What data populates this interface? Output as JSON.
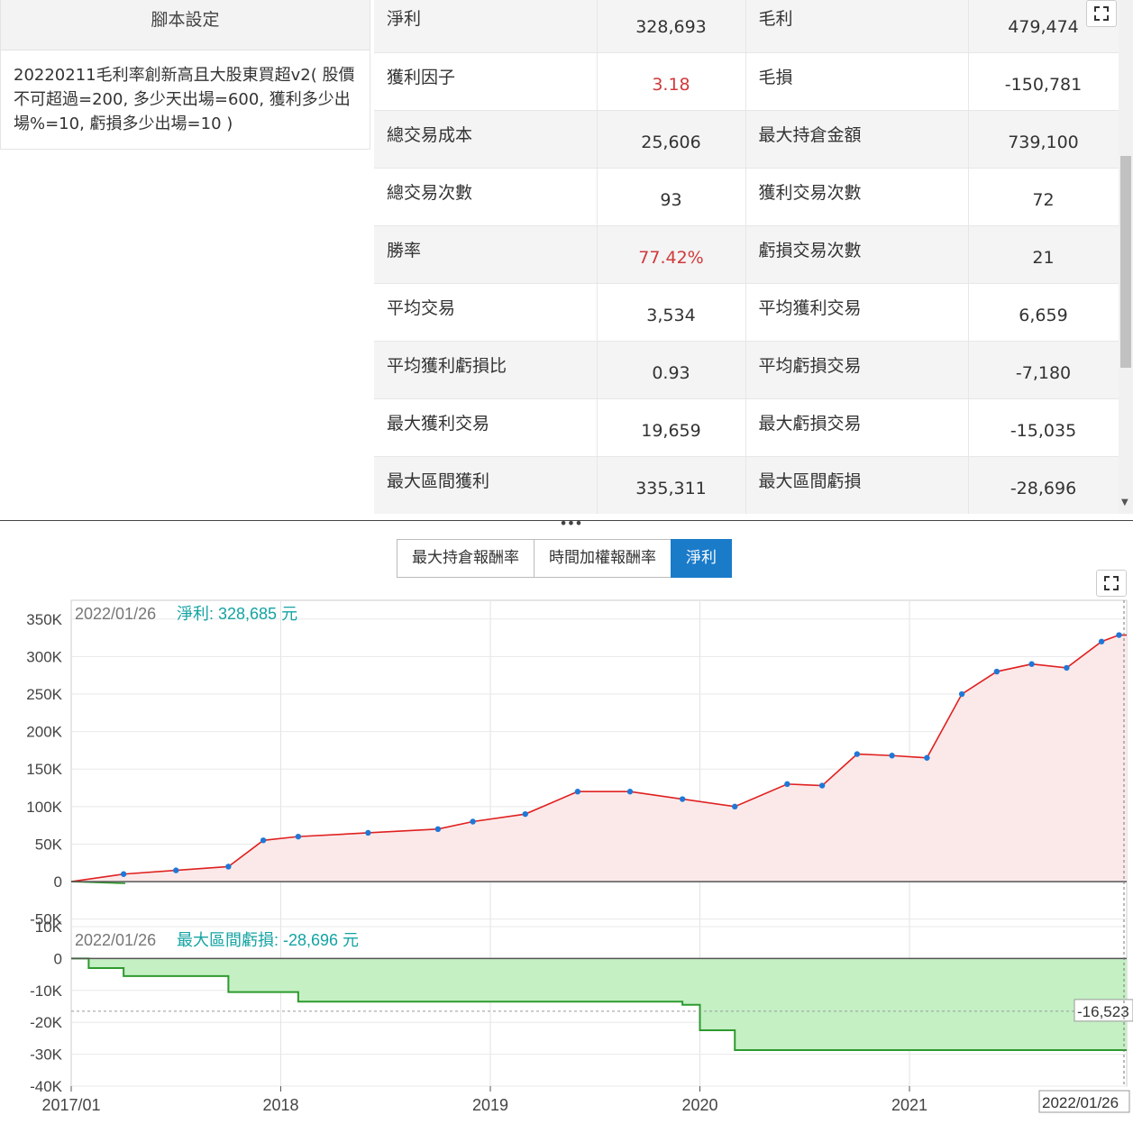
{
  "script_panel": {
    "header": "腳本設定",
    "text": "20220211毛利率創新高且大股東買超v2( 股價不可超過=200, 多少天出場=600, 獲利多少出場%=10, 虧損多少出場=10 )"
  },
  "stats": [
    {
      "l1": "淨利",
      "v1": "328,693",
      "l2": "毛利",
      "v2": "479,474"
    },
    {
      "l1": "獲利因子",
      "v1": "3.18",
      "l2": "毛損",
      "v2": "-150,781",
      "v1_red": true
    },
    {
      "l1": "總交易成本",
      "v1": "25,606",
      "l2": "最大持倉金額",
      "v2": "739,100"
    },
    {
      "l1": "總交易次數",
      "v1": "93",
      "l2": "獲利交易次數",
      "v2": "72"
    },
    {
      "l1": "勝率",
      "v1": "77.42%",
      "l2": "虧損交易次數",
      "v2": "21",
      "v1_red": true
    },
    {
      "l1": "平均交易",
      "v1": "3,534",
      "l2": "平均獲利交易",
      "v2": "6,659"
    },
    {
      "l1": "平均獲利虧損比",
      "v1": "0.93",
      "l2": "平均虧損交易",
      "v2": "-7,180"
    },
    {
      "l1": "最大獲利交易",
      "v1": "19,659",
      "l2": "最大虧損交易",
      "v2": "-15,035"
    },
    {
      "l1": "最大區間獲利",
      "v1": "335,311",
      "l2": "最大區間虧損",
      "v2": "-28,696"
    }
  ],
  "tabs": [
    {
      "label": "最大持倉報酬率",
      "active": false
    },
    {
      "label": "時間加權報酬率",
      "active": false
    },
    {
      "label": "淨利",
      "active": true
    }
  ],
  "icons": {
    "expand": "expand-icon",
    "scroll_down": "scroll-down-arrow-icon",
    "grip": "resize-grip-icon"
  },
  "colors": {
    "accent": "#1a7bc9",
    "red_value": "#d0393b",
    "teal_label": "#14a3a3",
    "equity_line": "#e02020",
    "trade_marker": "#1f78d8",
    "drawdown_line": "#2e9a2e",
    "drawdown_fill": "#c4f0c4"
  },
  "chart_data": [
    {
      "type": "line",
      "panel": "equity",
      "header_date": "2022/01/26",
      "header_label": "淨利: 328,685 元",
      "ylim": [
        -60000,
        375000
      ],
      "ytick_labels": [
        "350K",
        "300K",
        "250K",
        "200K",
        "150K",
        "100K",
        "50K",
        "0",
        "-50K"
      ],
      "ytick_values": [
        350000,
        300000,
        250000,
        200000,
        150000,
        100000,
        50000,
        0,
        -50000
      ],
      "x": [
        "2017/01",
        "2017/04",
        "2017/07",
        "2017/10",
        "2017/12",
        "2018/02",
        "2018/06",
        "2018/10",
        "2018/12",
        "2019/03",
        "2019/06",
        "2019/09",
        "2019/12",
        "2020/03",
        "2020/06",
        "2020/08",
        "2020/10",
        "2020/12",
        "2021/02",
        "2021/04",
        "2021/06",
        "2021/08",
        "2021/10",
        "2021/12",
        "2022/01"
      ],
      "series": [
        {
          "values": [
            0,
            10000,
            15000,
            20000,
            55000,
            60000,
            65000,
            70000,
            80000,
            90000,
            120000,
            120000,
            110000,
            100000,
            130000,
            128000,
            170000,
            168000,
            165000,
            250000,
            280000,
            290000,
            285000,
            320000,
            328685
          ]
        }
      ]
    },
    {
      "type": "area",
      "panel": "drawdown",
      "header_date": "2022/01/26",
      "header_label": "最大區間虧損: -28,696 元",
      "ylim": [
        -40000,
        10000
      ],
      "ytick_labels": [
        "10K",
        "0",
        "-10K",
        "-20K",
        "-30K",
        "-40K"
      ],
      "ytick_values": [
        10000,
        0,
        -10000,
        -20000,
        -30000,
        -40000
      ],
      "reference_label": "-16,523",
      "reference_value": -16523,
      "x_labels": [
        "2017/01",
        "2018",
        "2019",
        "2020",
        "2021",
        "2022/01/26"
      ],
      "x": [
        "2017/01",
        "2017/02",
        "2017/04",
        "2017/10",
        "2018/02",
        "2019/12",
        "2020/01",
        "2020/03",
        "2022/01"
      ],
      "series": [
        {
          "values": [
            0,
            -3000,
            -5500,
            -10500,
            -13500,
            -14500,
            -22500,
            -28696,
            -28696
          ]
        }
      ]
    }
  ]
}
